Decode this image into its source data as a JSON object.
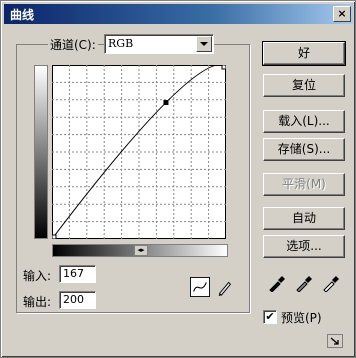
{
  "window": {
    "title": "曲线",
    "close_label": "×"
  },
  "channel": {
    "label": "通道(C):",
    "value": "RGB"
  },
  "input": {
    "label": "输入:",
    "value": "167"
  },
  "output": {
    "label": "输出:",
    "value": "200"
  },
  "buttons": {
    "ok": "好",
    "reset": "复位",
    "load": "载入(L)...",
    "save": "存储(S)...",
    "smooth": "平滑(M)",
    "auto": "自动",
    "options": "选项..."
  },
  "preview": {
    "label": "预览(P)",
    "checked": true
  },
  "curve": {
    "control_point": {
      "input": 167,
      "output": 200
    },
    "grid_divisions": 10
  },
  "icons": [
    "curve-tool-icon",
    "pencil-tool-icon",
    "black-eyedropper-icon",
    "gray-eyedropper-icon",
    "white-eyedropper-icon",
    "expand-icon"
  ]
}
